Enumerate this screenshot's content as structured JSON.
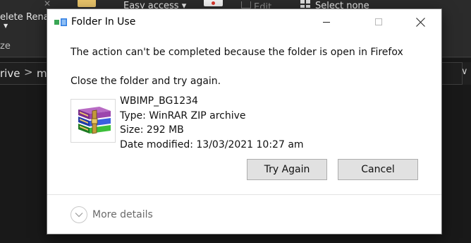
{
  "explorer": {
    "ribbon": {
      "delete_label": "elete",
      "rename_label": "Rena",
      "easy_access_label": "Easy access ▾",
      "edit_label": "Edit",
      "select_none_label": "Select none",
      "group_label": "ze"
    },
    "address": {
      "segment_1": "rive",
      "separator": ">",
      "segment_2": "m",
      "dropdown_icon": "chevron-down-icon"
    }
  },
  "dialog": {
    "title": "Folder In Use",
    "message": "The action can't be completed because the folder is open in Firefox",
    "instruction": "Close the folder and try again.",
    "file": {
      "name": "WBIMP_BG1234",
      "type_line": "Type: WinRAR ZIP archive",
      "size_line": "Size: 292 MB",
      "modified_line": "Date modified: 13/03/2021 10:27 am",
      "icon": "winrar-archive-icon"
    },
    "buttons": {
      "try_again": "Try Again",
      "cancel": "Cancel"
    },
    "more_details": "More details"
  },
  "colors": {
    "explorer_bg": "#191919",
    "ribbon_bg": "#2b2b2b",
    "dialog_bg": "#ffffff",
    "button_bg": "#e1e1e1",
    "button_border": "#adadad",
    "muted_text": "#6a6a6a"
  }
}
